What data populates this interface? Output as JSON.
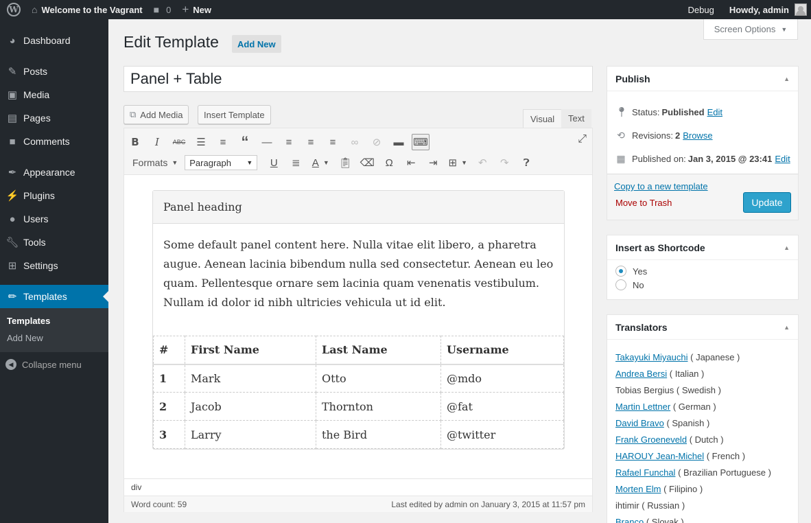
{
  "adminbar": {
    "site_title": "Welcome to the Vagrant",
    "comments_count": "0",
    "new_label": "New",
    "debug_label": "Debug",
    "howdy_label": "Howdy, admin"
  },
  "sidebar": {
    "items": [
      {
        "label": "Dashboard",
        "icon": "dashboard-icon"
      },
      {
        "label": "Posts",
        "icon": "pin-icon"
      },
      {
        "label": "Media",
        "icon": "media-icon"
      },
      {
        "label": "Pages",
        "icon": "pages-icon"
      },
      {
        "label": "Comments",
        "icon": "comments-icon"
      },
      {
        "label": "Appearance",
        "icon": "brush-icon"
      },
      {
        "label": "Plugins",
        "icon": "plug-icon"
      },
      {
        "label": "Users",
        "icon": "user-icon"
      },
      {
        "label": "Tools",
        "icon": "wrench-icon"
      },
      {
        "label": "Settings",
        "icon": "settings-icon"
      },
      {
        "label": "Templates",
        "icon": "pencil-icon"
      }
    ],
    "submenu": [
      "Templates",
      "Add New"
    ],
    "collapse_label": "Collapse menu"
  },
  "screen_options": "Screen Options",
  "page": {
    "title": "Edit Template",
    "add_new": "Add New",
    "post_title": "Panel + Table"
  },
  "media": {
    "add_media": "Add Media",
    "insert_template": "Insert Template"
  },
  "editor": {
    "tab_visual": "Visual",
    "tab_text": "Text",
    "formats_label": "Formats",
    "block_format": "Paragraph",
    "path": "div",
    "word_count": "Word count: 59",
    "last_edited": "Last edited by admin on January 3, 2015 at 11:57 pm"
  },
  "panel": {
    "heading": "Panel heading",
    "body": "Some default panel content here. Nulla vitae elit libero, a pharetra augue. Aenean lacinia bibendum nulla sed consectetur. Aenean eu leo quam. Pellentesque ornare sem lacinia quam venenatis vestibulum. Nullam id dolor id nibh ultricies vehicula ut id elit.",
    "table": {
      "headers": [
        "#",
        "First Name",
        "Last Name",
        "Username"
      ],
      "rows": [
        [
          "1",
          "Mark",
          "Otto",
          "@mdo"
        ],
        [
          "2",
          "Jacob",
          "Thornton",
          "@fat"
        ],
        [
          "3",
          "Larry",
          "the Bird",
          "@twitter"
        ]
      ]
    }
  },
  "publish": {
    "title": "Publish",
    "status_label": "Status:",
    "status_value": "Published",
    "status_edit": "Edit",
    "revisions_label": "Revisions:",
    "revisions_value": "2",
    "revisions_browse": "Browse",
    "published_label": "Published on:",
    "published_value": "Jan 3, 2015 @ 23:41",
    "published_edit": "Edit",
    "copy_link": "Copy to a new template",
    "trash_link": "Move to Trash",
    "update": "Update"
  },
  "shortcode": {
    "title": "Insert as Shortcode",
    "yes": "Yes",
    "no": "No"
  },
  "translators": {
    "title": "Translators",
    "items": [
      {
        "name": "Takayuki Miyauchi",
        "lang": "( Japanese )",
        "link": true
      },
      {
        "name": "Andrea Bersi",
        "lang": "( Italian )",
        "link": true
      },
      {
        "name": "Tobias Bergius",
        "lang": "( Swedish )",
        "link": false
      },
      {
        "name": "Martin Lettner",
        "lang": "( German )",
        "link": true
      },
      {
        "name": "David Bravo",
        "lang": "( Spanish )",
        "link": true
      },
      {
        "name": "Frank Groeneveld",
        "lang": "( Dutch )",
        "link": true
      },
      {
        "name": "HAROUY Jean-Michel",
        "lang": "( French )",
        "link": true
      },
      {
        "name": "Rafael Funchal",
        "lang": "( Brazilian Portuguese )",
        "link": true
      },
      {
        "name": "Morten Elm",
        "lang": "( Filipino )",
        "link": true
      },
      {
        "name": "ihtimir",
        "lang": "( Russian )",
        "link": false
      },
      {
        "name": "Branco",
        "lang": "( Slovak )",
        "link": true
      }
    ]
  },
  "colors": {
    "adminbar_bg": "#23282d",
    "accent": "#0073aa",
    "update_button": "#2ea2cc",
    "trash": "#aa0000"
  }
}
